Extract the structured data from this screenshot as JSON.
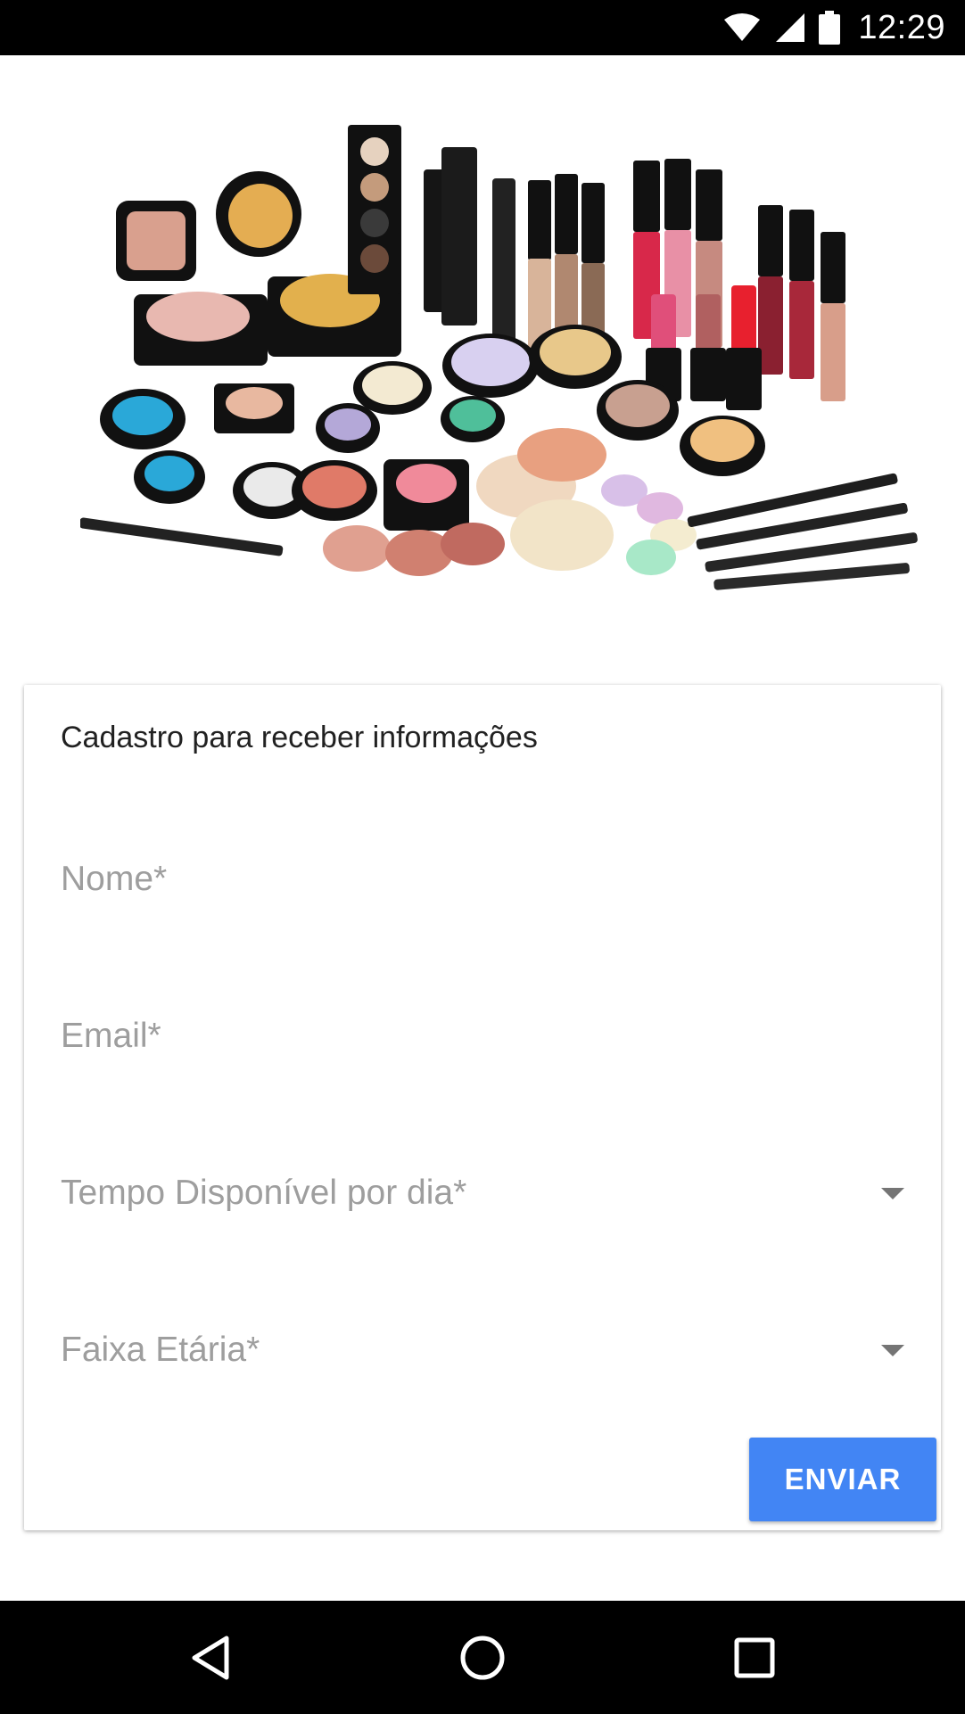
{
  "status_bar": {
    "time": "12:29",
    "icons": [
      "wifi-icon",
      "cell-signal-icon",
      "battery-icon"
    ]
  },
  "hero": {
    "image": "makeup-products-photo"
  },
  "form": {
    "title": "Cadastro para receber informações",
    "fields": [
      {
        "placeholder": "Nome*",
        "type": "text"
      },
      {
        "placeholder": "Email*",
        "type": "text"
      },
      {
        "placeholder": "Tempo Disponível por dia*",
        "type": "select"
      },
      {
        "placeholder": "Faixa Etária*",
        "type": "select"
      }
    ],
    "submit_label": "ENVIAR"
  },
  "nav_bar": {
    "icons": [
      "back-icon",
      "home-icon",
      "recents-icon"
    ]
  },
  "colors": {
    "accent": "#4285f4",
    "status_bar": "#000000",
    "placeholder": "#9e9e9e"
  }
}
